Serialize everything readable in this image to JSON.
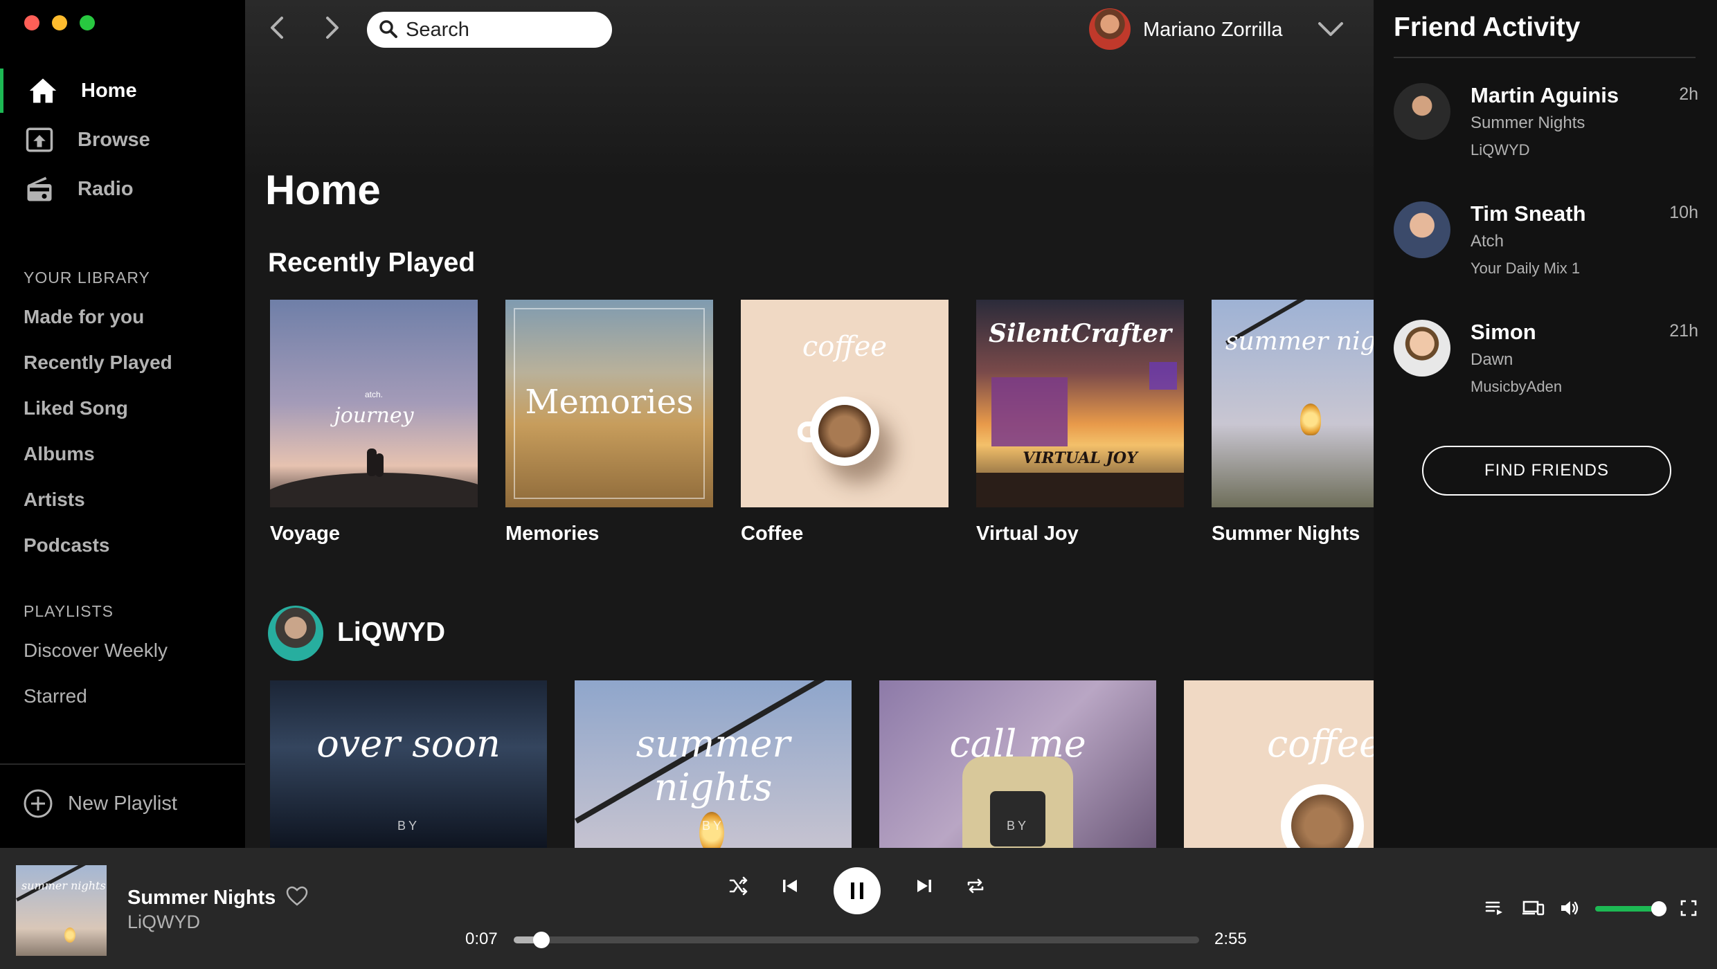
{
  "window": {
    "traffic_lights": [
      "#ff5f57",
      "#febc2e",
      "#28c840"
    ]
  },
  "sidebar": {
    "nav": [
      {
        "label": "Home",
        "icon": "home-icon",
        "active": true
      },
      {
        "label": "Browse",
        "icon": "browse-icon",
        "active": false
      },
      {
        "label": "Radio",
        "icon": "radio-icon",
        "active": false
      }
    ],
    "library_title": "YOUR LIBRARY",
    "library": [
      "Made for you",
      "Recently Played",
      "Liked Song",
      "Albums",
      "Artists",
      "Podcasts"
    ],
    "playlists_title": "PLAYLISTS",
    "playlists": [
      "Discover Weekly",
      "Starred"
    ],
    "new_playlist": "New Playlist"
  },
  "header": {
    "search_placeholder": "Search",
    "user_name": "Mariano Zorrilla"
  },
  "main": {
    "title": "Home",
    "recently_played_title": "Recently Played",
    "recently_played": [
      {
        "label": "Voyage",
        "cover_lines": [
          "atch.",
          "journey"
        ]
      },
      {
        "label": "Memories",
        "cover_lines": [
          "Memories"
        ]
      },
      {
        "label": "Coffee",
        "cover_lines": [
          "coffee"
        ]
      },
      {
        "label": "Virtual Joy",
        "cover_lines": [
          "SilentCrafter",
          "VIRTUAL JOY"
        ]
      },
      {
        "label": "Summer Nights",
        "cover_lines": [
          "summer nights"
        ]
      }
    ],
    "artist_name": "LiQWYD",
    "artist_albums": [
      {
        "cover_text": "over soon",
        "by": "BY"
      },
      {
        "cover_text": "summer nights",
        "by": "BY"
      },
      {
        "cover_text": "call me",
        "by": "BY"
      },
      {
        "cover_text": "coffee",
        "by": ""
      }
    ]
  },
  "friend_activity": {
    "title": "Friend Activity",
    "friends": [
      {
        "name": "Martin Aguinis",
        "time": "2h",
        "track": "Summer Nights",
        "context": "LiQWYD"
      },
      {
        "name": "Tim Sneath",
        "time": "10h",
        "track": "Atch",
        "context": "Your Daily Mix 1"
      },
      {
        "name": "Simon",
        "time": "21h",
        "track": "Dawn",
        "context": "MusicbyAden"
      }
    ],
    "find_friends": "FIND FRIENDS"
  },
  "player": {
    "title": "Summer Nights",
    "artist": "LiQWYD",
    "art_text": "summer nights",
    "elapsed": "0:07",
    "total": "2:55",
    "progress_fraction": 0.04,
    "volume_fraction": 0.88,
    "accent": "#1db954"
  }
}
